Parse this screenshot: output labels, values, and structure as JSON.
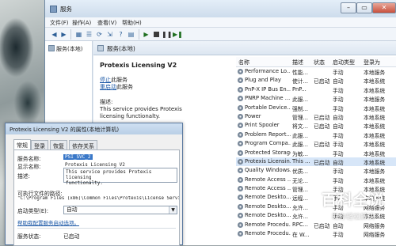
{
  "window": {
    "title": "服务"
  },
  "menu": [
    "文件(F)",
    "操作(A)",
    "查看(V)",
    "帮助(H)"
  ],
  "tree": {
    "root": "服务(本地)"
  },
  "pane": {
    "header": "服务(本地)",
    "service_title": "Protexis Licensing V2",
    "stop_link": "停止",
    "stop_suffix": "此服务",
    "restart_link": "重启动",
    "restart_suffix": "此服务",
    "desc_label": "描述:",
    "desc_line1": "This service provides Protexis",
    "desc_line2": "licensing functionalty."
  },
  "grid": {
    "columns": [
      "名称",
      "描述",
      "状态",
      "启动类型",
      "登录为"
    ],
    "rows": [
      [
        "Performance Lo...",
        "性能...",
        "",
        "手动",
        "本地服务"
      ],
      [
        "Plug and Play",
        "使计...",
        "已启动",
        "自动",
        "本地系统"
      ],
      [
        "PnP-X IP Bus En...",
        "PnP...",
        "",
        "手动",
        "本地系统"
      ],
      [
        "PNRP Machine ...",
        "此服...",
        "",
        "手动",
        "本地服务"
      ],
      [
        "Portable Device...",
        "强制...",
        "",
        "手动",
        "本地系统"
      ],
      [
        "Power",
        "管理...",
        "已启动",
        "自动",
        "本地系统"
      ],
      [
        "Print Spooler",
        "将文...",
        "已启动",
        "自动",
        "本地系统"
      ],
      [
        "Problem Report...",
        "此服...",
        "",
        "手动",
        "本地系统"
      ],
      [
        "Program Compa...",
        "此服...",
        "已启动",
        "手动",
        "本地系统"
      ],
      [
        "Protected Storage",
        "为敏...",
        "",
        "手动",
        "本地系统"
      ],
      [
        "Protexis Licensin...",
        "This ...",
        "已启动",
        "自动",
        "本地系统"
      ],
      [
        "Quality Windows...",
        "优质...",
        "",
        "手动",
        "本地服务"
      ],
      [
        "Remote Access ...",
        "无论...",
        "",
        "手动",
        "本地系统"
      ],
      [
        "Remote Access ...",
        "管理...",
        "",
        "手动",
        "本地系统"
      ],
      [
        "Remote Deskto...",
        "远程...",
        "",
        "手动",
        "本地系统"
      ],
      [
        "Remote Deskto...",
        "允许...",
        "",
        "手动",
        "网络服务"
      ],
      [
        "Remote Deskto...",
        "允许...",
        "",
        "手动",
        "本地系统"
      ],
      [
        "Remote Procedu...",
        "RPC...",
        "已启动",
        "自动",
        "网络服务"
      ],
      [
        "Remote Procedu...",
        "在 W...",
        "",
        "手动",
        "网络服务"
      ]
    ],
    "selected_index": 10
  },
  "dialog": {
    "title": "Protexis Licensing V2 的属性(本地计算机)",
    "tabs": [
      "常规",
      "登录",
      "恢复",
      "依存关系"
    ],
    "service_name_label": "服务名称:",
    "service_name_value": "PSI_SVC_2",
    "display_name_label": "显示名称:",
    "display_name_value": "Protexis Licensing V2",
    "desc_label": "描述:",
    "desc_line1": "This service provides Protexis licensing",
    "desc_line2": "functionalty.",
    "path_label": "可执行文件的路径:",
    "path_value": "\"C:\\Program Files (x86)\\Common Files\\Protexis\\License Servic",
    "startup_label": "启动类型(E):",
    "startup_value": "自动",
    "help_link": "帮助我配置服务启动选项。",
    "status_label": "服务状态:",
    "status_value": "已启动"
  },
  "watermark": {
    "big": "百科全说",
    "small": "助你轻松解决"
  }
}
